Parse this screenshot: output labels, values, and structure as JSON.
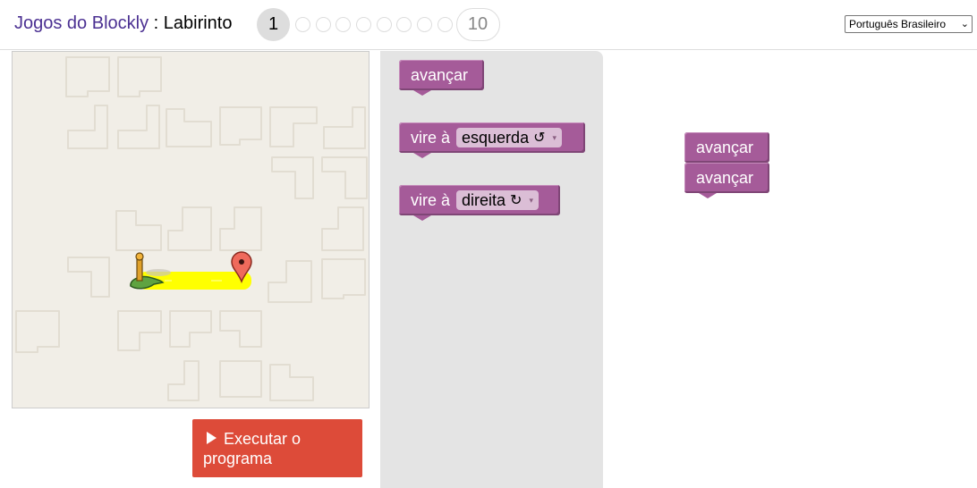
{
  "header": {
    "app_link": "Jogos do Blockly",
    "separator": " : ",
    "game_name": "Labirinto",
    "level_current": "1",
    "level_last": "10",
    "language": "Português Brasileiro"
  },
  "run_button": {
    "label": "Executar o programa"
  },
  "flyout": {
    "block_forward": "avançar",
    "block_turn_left_prefix": "vire à",
    "block_turn_left_value": "esquerda",
    "block_turn_left_symbol": "↺",
    "block_turn_right_prefix": "vire à",
    "block_turn_right_value": "direita",
    "block_turn_right_symbol": "↻",
    "dropdown_arrow": "▾"
  },
  "workspace": {
    "blocks": [
      "avançar",
      "avançar"
    ]
  },
  "colors": {
    "block_motion": "#a55b99",
    "run_button": "#dd4b39",
    "path_highlight": "#ffff00",
    "title_link": "#4b3092",
    "maze_background": "#f1eee7"
  },
  "icons": {
    "player": "pegman-pin-icon",
    "goal": "map-marker-icon",
    "play": "play-icon"
  }
}
